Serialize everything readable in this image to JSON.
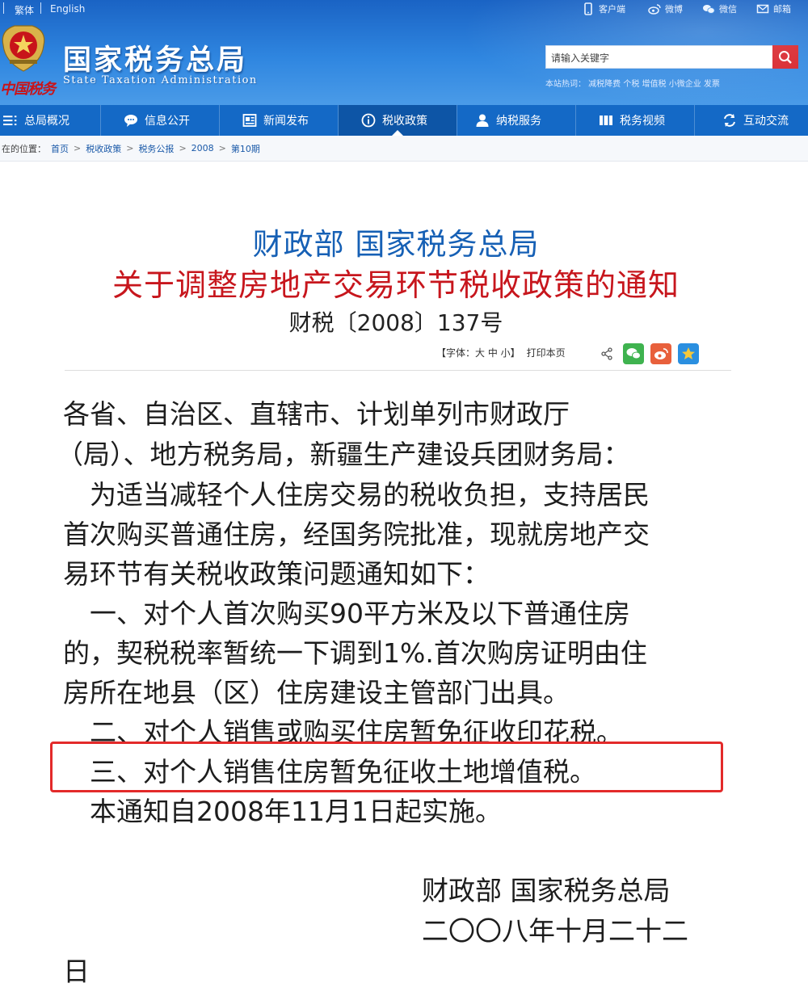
{
  "topbar": {
    "lang_traditional": "繁体",
    "lang_english": "English",
    "links": [
      {
        "label": "客户端",
        "icon": "mobile-icon"
      },
      {
        "label": "微博",
        "icon": "weibo-icon"
      },
      {
        "label": "微信",
        "icon": "wechat-icon"
      },
      {
        "label": "邮箱",
        "icon": "mail-icon"
      }
    ]
  },
  "header": {
    "title": "国家税务总局",
    "title_en": "State Taxation Administration",
    "logo_text": "中国税务",
    "search_placeholder": "请输入关键字",
    "hot_words": "本站热词： 减税降费 个税 增值税 小微企业 发票"
  },
  "nav": {
    "items": [
      {
        "label": "总局概况",
        "icon": "menu-icon"
      },
      {
        "label": "信息公开",
        "icon": "chat-bubble-icon"
      },
      {
        "label": "新闻发布",
        "icon": "news-icon"
      },
      {
        "label": "税收政策",
        "icon": "info-circle-icon",
        "active": true
      },
      {
        "label": "纳税服务",
        "icon": "user-icon"
      },
      {
        "label": "税务视频",
        "icon": "video-icon"
      },
      {
        "label": "互动交流",
        "icon": "refresh-icon"
      }
    ]
  },
  "breadcrumb": {
    "prefix": "在的位置：",
    "items": [
      "首页",
      "税收政策",
      "税务公报",
      "2008",
      "第10期"
    ]
  },
  "article": {
    "title_line1": "财政部 国家税务总局",
    "title_line2": "关于调整房地产交易环节税收政策的通知",
    "doc_number": "财税〔2008〕137号",
    "font_tool": "【字体：大 中 小】",
    "print_label": "打印本页",
    "lines": [
      "各省、自治区、直辖市、计划单列市财政厅",
      "（局）、地方税务局，新疆生产建设兵团财务局：",
      "　为适当减轻个人住房交易的税收负担，支持居民",
      "首次购买普通住房，经国务院批准，现就房地产交",
      "易环节有关税收政策问题通知如下：",
      "　一、对个人首次购买90平方米及以下普通住房",
      "的，契税税率暂统一下调到1%.首次购房证明由住",
      "房所在地县（区）住房建设主管部门出具。",
      "　二、对个人销售或购买住房暂免征收印花税。",
      "　三、对个人销售住房暂免征收土地增值税。",
      "　本通知自2008年11月1日起实施。"
    ],
    "signature": "财政部  国家税务总局",
    "date_line1": "二〇〇八年十月二十二",
    "date_line2": "日"
  },
  "colors": {
    "header_blue": "#2f86e0",
    "nav_blue": "#1469c6",
    "title_blue": "#1660b5",
    "title_red": "#c7161d",
    "highlight_red": "#e32a2a"
  }
}
